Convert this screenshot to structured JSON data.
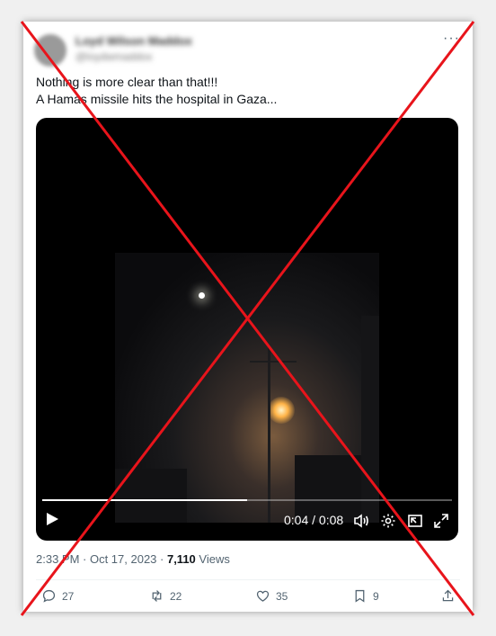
{
  "tweet": {
    "author_name": "Loyd Wilson Maddox",
    "author_handle": "@loydwmaddox",
    "more_label": "···",
    "lines": [
      "Nothing is more clear than that!!!",
      "A Hamas missile hits the hospital in Gaza..."
    ]
  },
  "video": {
    "time_label": "0:04 / 0:08",
    "progress": 0.5,
    "icons": [
      "play-icon",
      "volume-icon",
      "settings-icon",
      "pip-icon",
      "fullscreen-icon"
    ]
  },
  "meta": {
    "timestamp": "2:33 PM · Oct 17, 2023 · ",
    "views_count": "7,110",
    "views_label": " Views"
  },
  "actions": {
    "replies": "27",
    "reposts": "22",
    "likes": "35",
    "bookmarks": "9"
  },
  "overlay": {
    "mark": "red-x",
    "color": "#e8141b"
  }
}
